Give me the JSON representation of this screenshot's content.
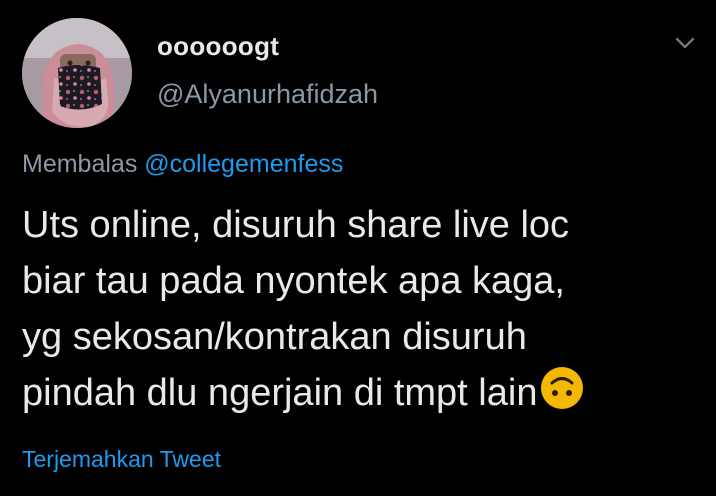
{
  "tweet": {
    "display_name": "oooooogt",
    "handle": "@Alyanurhafidzah",
    "reply_prefix": "Membalas ",
    "reply_mention": "@collegemenfess",
    "body_lines": [
      "Uts online, disuruh share live loc",
      "biar tau pada nyontek apa kaga,",
      "yg sekosan/kontrakan disuruh",
      "pindah dlu ngerjain di tmpt lain"
    ],
    "emoji": "upside-down-face",
    "translate_label": "Terjemahkan Tweet"
  },
  "icons": {
    "menu": "chevron-down-icon",
    "avatar": "profile-photo"
  },
  "colors": {
    "background": "#000000",
    "text_primary": "#e7e9ea",
    "text_secondary": "#8b98a5",
    "accent": "#1d9bf0",
    "emoji": "#f5b800"
  }
}
